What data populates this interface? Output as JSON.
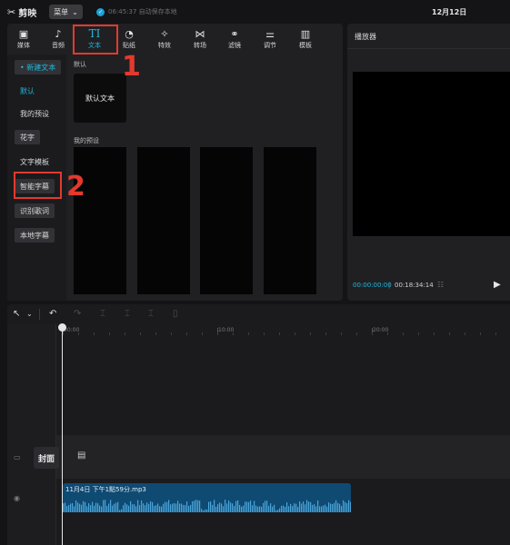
{
  "app": {
    "name": "剪映",
    "menu_label": "菜单",
    "save_status": "06:45:37 自动保存本地",
    "date": "12月12日"
  },
  "tabs": [
    {
      "label": "媒体",
      "icon": "media-icon",
      "glyph": "▣"
    },
    {
      "label": "音频",
      "icon": "music-note-icon",
      "glyph": "♪"
    },
    {
      "label": "文本",
      "icon": "text-icon",
      "glyph": "TI"
    },
    {
      "label": "贴纸",
      "icon": "sticker-icon",
      "glyph": "◔"
    },
    {
      "label": "特效",
      "icon": "effects-star-icon",
      "glyph": "✧"
    },
    {
      "label": "转场",
      "icon": "transition-icon",
      "glyph": "⋈"
    },
    {
      "label": "滤镜",
      "icon": "filter-icon",
      "glyph": "⚭"
    },
    {
      "label": "调节",
      "icon": "adjust-sliders-icon",
      "glyph": "⚌"
    },
    {
      "label": "模板",
      "icon": "template-icon",
      "glyph": "▥"
    }
  ],
  "sidebar": {
    "items": [
      {
        "label": "• 新建文本"
      },
      {
        "label": "默认"
      },
      {
        "label": "我的预设"
      },
      {
        "label": "花字"
      },
      {
        "label": "文字模板"
      },
      {
        "label": "智能字幕"
      },
      {
        "label": "识别歌词"
      },
      {
        "label": "本地字幕"
      }
    ]
  },
  "content": {
    "default_section": "默认",
    "default_card": "默认文本",
    "presets_section": "我的预设"
  },
  "annotations": {
    "marker_1": "1",
    "marker_2": "2"
  },
  "player": {
    "title": "播放器",
    "current_time": "00:00:00:00",
    "separator": "|",
    "total_time": "00:18:34:14"
  },
  "timeline": {
    "ruler_ticks": [
      "00:00",
      "10:00",
      "20:00"
    ],
    "cover_label": "封面",
    "audio_clip_label": "11月4日 下午1點59分.mp3"
  },
  "colors": {
    "accent": "#1fb8de",
    "annotation": "#e23a2e",
    "audio_clip": "#0f4a72"
  }
}
